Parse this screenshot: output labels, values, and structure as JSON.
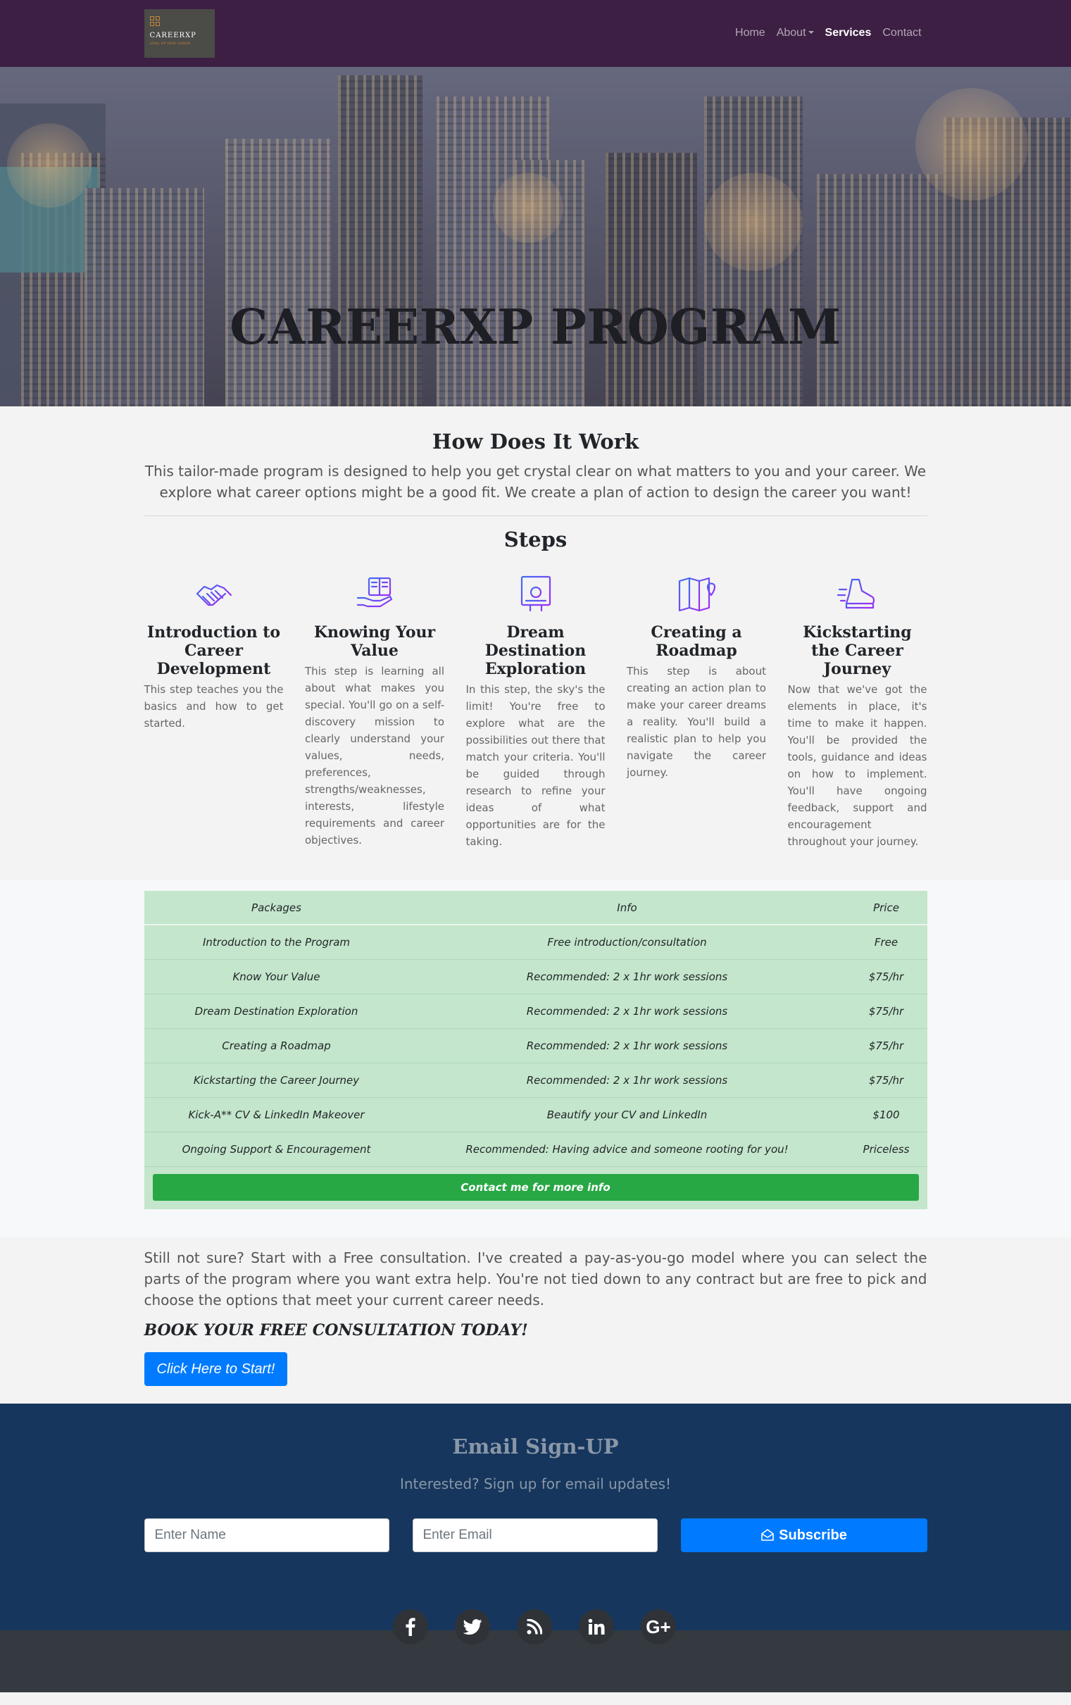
{
  "nav": {
    "logo_text": "CAREERXP",
    "logo_tagline": "LEVEL UP YOUR CAREER",
    "items": [
      {
        "label": "Home"
      },
      {
        "label": "About"
      },
      {
        "label": "Services"
      },
      {
        "label": "Contact"
      }
    ],
    "active": "Services"
  },
  "hero": {
    "title": "CAREERXP PROGRAM"
  },
  "how": {
    "title": "How Does It Work",
    "lead": "This tailor-made program is designed to help you get crystal clear on what matters to you and your career. We explore what career options might be a good fit. We create a plan of action to design the career you want!",
    "steps_title": "Steps"
  },
  "steps": [
    {
      "icon": "handshake-icon",
      "title": "Introduction to Career Development",
      "text": "This step teaches you the basics and how to get started."
    },
    {
      "icon": "book-hand-icon",
      "title": "Knowing Your Value",
      "text": "This step is learning all about what makes you special. You'll go on a self-discovery mission to clearly understand your values, needs, preferences, strengths/weaknesses, interests, lifestyle requirements and career objectives."
    },
    {
      "icon": "presentation-board-icon",
      "title": "Dream Destination Exploration",
      "text": "In this step, the sky's the limit! You're free to explore what are the possibilities out there that match your criteria. You'll be guided through research to refine your ideas of what opportunities are for the taking."
    },
    {
      "icon": "map-pin-icon",
      "title": "Creating a Roadmap",
      "text": "This step is about creating an action plan to make your career dreams a reality. You'll build a realistic plan to help you navigate the career journey."
    },
    {
      "icon": "running-shoe-icon",
      "title": "Kickstarting the Career Journey",
      "text": "Now that we've got the elements in place, it's time to make it happen. You'll be provided the tools, guidance and ideas on how to implement. You'll have ongoing feedback, support and encouragement throughout your journey."
    }
  ],
  "pricing": {
    "headers": [
      "Packages",
      "Info",
      "Price"
    ],
    "rows": [
      [
        "Introduction to the Program",
        "Free introduction/consultation",
        "Free"
      ],
      [
        "Know Your Value",
        "Recommended: 2 x 1hr work sessions",
        "$75/hr"
      ],
      [
        "Dream Destination Exploration",
        "Recommended: 2 x 1hr work sessions",
        "$75/hr"
      ],
      [
        "Creating a Roadmap",
        "Recommended: 2 x 1hr work sessions",
        "$75/hr"
      ],
      [
        "Kickstarting the Career Journey",
        "Recommended: 2 x 1hr work sessions",
        "$75/hr"
      ],
      [
        "Kick-A** CV & LinkedIn Makeover",
        "Beautify your CV and LinkedIn",
        "$100"
      ],
      [
        "Ongoing Support & Encouragement",
        "Recommended: Having advice and someone rooting for you!",
        "Priceless"
      ]
    ],
    "cta_label": "Contact me for more info"
  },
  "consult": {
    "text": "Still not sure? Start with a Free consultation. I've created a pay-as-you-go model where you can select the parts of the program where you want extra help. You're not tied down to any contract but are free to pick and choose the options that meet your current career needs.",
    "heading": "BOOK YOUR FREE CONSULTATION TODAY!",
    "button": "Click Here to Start!"
  },
  "signup": {
    "title": "Email Sign-UP",
    "subtitle": "Interested? Sign up for email updates!",
    "name_placeholder": "Enter Name",
    "email_placeholder": "Enter Email",
    "button": "Subscribe"
  },
  "social": [
    {
      "icon": "facebook-icon",
      "glyph": "f"
    },
    {
      "icon": "twitter-icon",
      "glyph": "t"
    },
    {
      "icon": "rss-icon",
      "glyph": "r"
    },
    {
      "icon": "linkedin-icon",
      "glyph": "in"
    },
    {
      "icon": "google-plus-icon",
      "glyph": "G+"
    }
  ],
  "colors": {
    "nav_bg": "#3d1f43",
    "table_bg": "#c4e6cc",
    "cta_green": "#28a745",
    "primary_blue": "#007bff",
    "signup_bg": "#16365d",
    "footer_bg": "#343a40",
    "icon_gradient": [
      "#3f6cf0",
      "#a02bf5"
    ]
  }
}
